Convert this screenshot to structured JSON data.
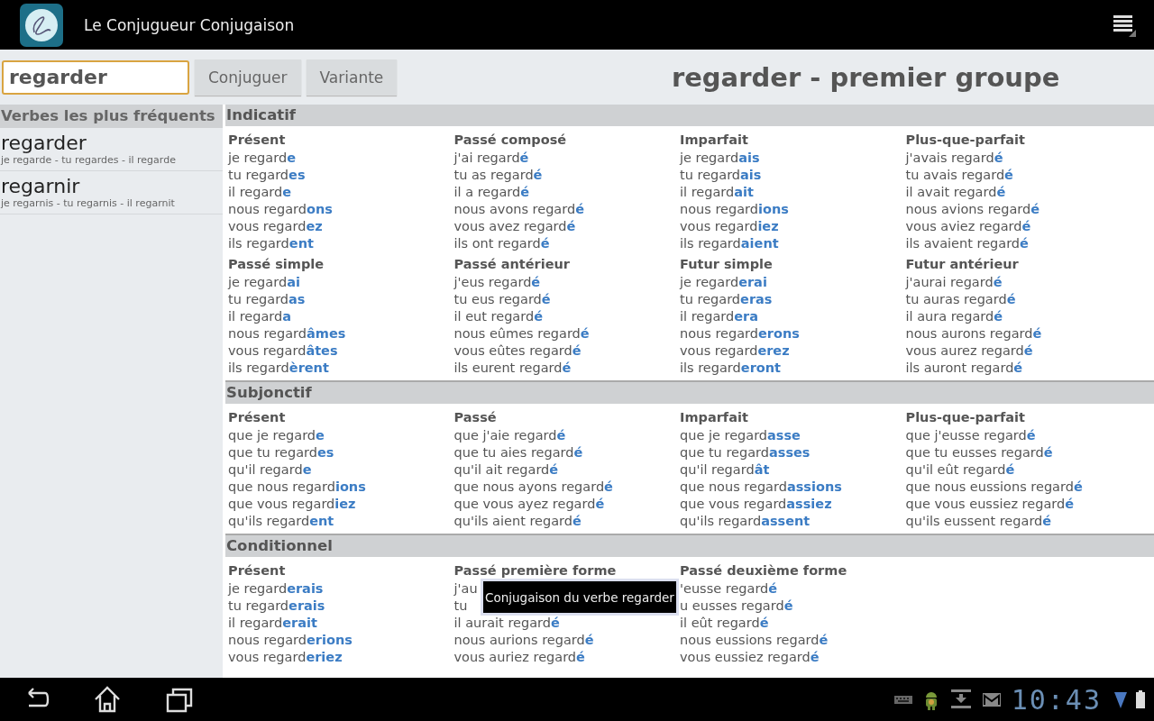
{
  "app_bar": {
    "title": "Le Conjugueur Conjugaison"
  },
  "search": {
    "value": "regarder"
  },
  "buttons": [
    "Conjuguer",
    "Variante"
  ],
  "verb_title": "regarder - premier groupe",
  "sidebar": {
    "heading": "Verbes les plus fréquents",
    "items": [
      {
        "verb": "regarder",
        "forms": "je regarde - tu regardes - il regarde"
      },
      {
        "verb": "regarnir",
        "forms": "je regarnis - tu regarnis - il regarnit"
      }
    ]
  },
  "sections": [
    {
      "title": "Indicatif",
      "tenses": [
        {
          "name": "Présent",
          "lines": [
            "je regard**e**",
            "tu regard**es**",
            "il regard**e**",
            "nous regard**ons**",
            "vous regard**ez**",
            "ils regard**ent**"
          ]
        },
        {
          "name": "Passé composé",
          "lines": [
            "j'ai regard**é**",
            "tu as regard**é**",
            "il a regard**é**",
            "nous avons regard**é**",
            "vous avez regard**é**",
            "ils ont regard**é**"
          ]
        },
        {
          "name": "Imparfait",
          "lines": [
            "je regard**ais**",
            "tu regard**ais**",
            "il regard**ait**",
            "nous regard**ions**",
            "vous regard**iez**",
            "ils regard**aient**"
          ]
        },
        {
          "name": "Plus-que-parfait",
          "lines": [
            "j'avais regard**é**",
            "tu avais regard**é**",
            "il avait regard**é**",
            "nous avions regard**é**",
            "vous aviez regard**é**",
            "ils avaient regard**é**"
          ]
        },
        {
          "name": "Passé simple",
          "lines": [
            "je regard**ai**",
            "tu regard**as**",
            "il regard**a**",
            "nous regard**âmes**",
            "vous regard**âtes**",
            "ils regard**èrent**"
          ]
        },
        {
          "name": "Passé antérieur",
          "lines": [
            "j'eus regard**é**",
            "tu eus regard**é**",
            "il eut regard**é**",
            "nous eûmes regard**é**",
            "vous eûtes regard**é**",
            "ils eurent regard**é**"
          ]
        },
        {
          "name": "Futur simple",
          "lines": [
            "je regard**erai**",
            "tu regard**eras**",
            "il regard**era**",
            "nous regard**erons**",
            "vous regard**erez**",
            "ils regard**eront**"
          ]
        },
        {
          "name": "Futur antérieur",
          "lines": [
            "j'aurai regard**é**",
            "tu auras regard**é**",
            "il aura regard**é**",
            "nous aurons regard**é**",
            "vous aurez regard**é**",
            "ils auront regard**é**"
          ]
        }
      ]
    },
    {
      "title": "Subjonctif",
      "tenses": [
        {
          "name": "Présent",
          "lines": [
            "que je regard**e**",
            "que tu regard**es**",
            "qu'il regard**e**",
            "que nous regard**ions**",
            "que vous regard**iez**",
            "qu'ils regard**ent**"
          ]
        },
        {
          "name": "Passé",
          "lines": [
            "que j'aie regard**é**",
            "que tu aies regard**é**",
            "qu'il ait regard**é**",
            "que nous ayons regard**é**",
            "que vous ayez regard**é**",
            "qu'ils aient regard**é**"
          ]
        },
        {
          "name": "Imparfait",
          "lines": [
            "que je regard**asse**",
            "que tu regard**asses**",
            "qu'il regard**ât**",
            "que nous regard**assions**",
            "que vous regard**assiez**",
            "qu'ils regard**assent**"
          ]
        },
        {
          "name": "Plus-que-parfait",
          "lines": [
            "que j'eusse regard**é**",
            "que tu eusses regard**é**",
            "qu'il eût regard**é**",
            "que nous eussions regard**é**",
            "que vous eussiez regard**é**",
            "qu'ils eussent regard**é**"
          ]
        }
      ]
    },
    {
      "title": "Conditionnel",
      "tenses": [
        {
          "name": "Présent",
          "lines": [
            "je regard**erais**",
            "tu regard**erais**",
            "il regard**erait**",
            "nous regard**erions**",
            "vous regard**eriez**"
          ]
        },
        {
          "name": "Passé première forme",
          "lines": [
            "j'au",
            "tu",
            "il aurait regard**é**",
            "nous aurions regard**é**",
            "vous auriez regard**é**"
          ]
        },
        {
          "name": "Passé deuxième forme",
          "lines": [
            "'eusse regard**é**",
            "u eusses regard**é**",
            "il eût regard**é**",
            "nous eussions regard**é**",
            "vous eussiez regard**é**"
          ]
        }
      ]
    }
  ],
  "toast": {
    "text": "Conjugaison du verbe regarder"
  },
  "status_bar": {
    "time": "10:43"
  }
}
